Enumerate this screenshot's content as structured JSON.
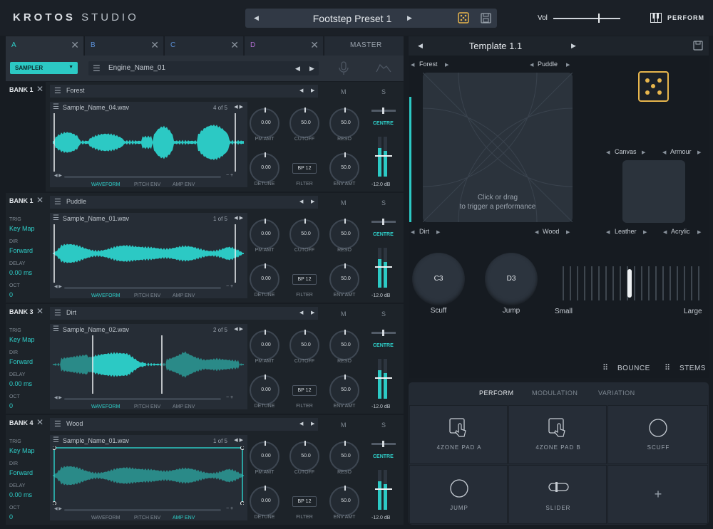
{
  "header": {
    "logo_bold": "KROTOS",
    "logo_light": "STUDIO",
    "preset_name": "Footstep Preset 1",
    "vol_label": "Vol",
    "perform_label": "PERFORM"
  },
  "tabs": [
    {
      "label": "A"
    },
    {
      "label": "B"
    },
    {
      "label": "C"
    },
    {
      "label": "D"
    },
    {
      "label": "MASTER"
    }
  ],
  "engine": {
    "type": "SAMPLER",
    "name": "Engine_Name_01"
  },
  "banks": [
    {
      "bank": "BANK 1",
      "name": "Forest",
      "sample": "Sample_Name_04.wav",
      "page": "4 of 5",
      "options": null,
      "active_tab": "WAVEFORM"
    },
    {
      "bank": "BANK 1",
      "name": "Puddle",
      "sample": "Sample_Name_01.wav",
      "page": "1 of 5",
      "options": {
        "trig_k": "TRIG",
        "trig_v": "Key Map",
        "dir_k": "DIR",
        "dir_v": "Forward",
        "delay_k": "DELAY",
        "delay_v": "0.00 ms",
        "oct_k": "OCT",
        "oct_v": "0"
      },
      "active_tab": "WAVEFORM"
    },
    {
      "bank": "BANK 3",
      "name": "Dirt",
      "sample": "Sample_Name_02.wav",
      "page": "2 of 5",
      "options": {
        "trig_k": "TRIG",
        "trig_v": "Key Map",
        "dir_k": "DIR",
        "dir_v": "Forward",
        "delay_k": "DELAY",
        "delay_v": "0.00 ms",
        "oct_k": "OCT",
        "oct_v": "0"
      },
      "active_tab": "WAVEFORM"
    },
    {
      "bank": "BANK 4",
      "name": "Wood",
      "sample": "Sample_Name_01.wav",
      "page": "1 of 5",
      "options": {
        "trig_k": "TRIG",
        "trig_v": "Key Map",
        "dir_k": "DIR",
        "dir_v": "Forward",
        "delay_k": "DELAY",
        "delay_v": "0.00 ms",
        "oct_k": "OCT",
        "oct_v": "0"
      },
      "active_tab": "AMP ENV"
    }
  ],
  "bank_controls": {
    "pm_amt": "0.00",
    "cutoff": "50.0",
    "reso": "50.0",
    "detune": "0.00",
    "filter": "BP 12",
    "env_amt": "50.0",
    "pm_amt_label": "PM AMT",
    "cutoff_label": "CUTOFF",
    "reso_label": "RESO",
    "detune_label": "DETUNE",
    "filter_label": "FILTER",
    "env_amt_label": "ENV AMT",
    "m": "M",
    "s": "S",
    "centre": "CENTRE",
    "db": "-12.0 dB",
    "tab_waveform": "WAVEFORM",
    "tab_pitch": "PITCH ENV",
    "tab_amp": "AMP ENV"
  },
  "right": {
    "template": "Template 1.1",
    "xy_tl": "Forest",
    "xy_tr": "Puddle",
    "xy_bl": "Dirt",
    "xy_br": "Wood",
    "xy_hint1": "Click or drag",
    "xy_hint2": "to trigger a performance",
    "mini_tl": "Canvas",
    "mini_tr": "Armour",
    "mini_bl": "Leather",
    "mini_br": "Acrylic",
    "pad1_note": "C3",
    "pad1_label": "Scuff",
    "pad2_note": "D3",
    "pad2_label": "Jump",
    "slider_small": "Small",
    "slider_large": "Large",
    "bounce": "BOUNCE",
    "stems": "STEMS"
  },
  "bottom": {
    "tabs": [
      "PERFORM",
      "MODULATION",
      "VARIATION"
    ],
    "cells": [
      "4ZONE PAD A",
      "4ZONE PAD B",
      "SCUFF",
      "JUMP",
      "SLIDER",
      "+"
    ]
  },
  "colors": {
    "accent": "#2cc9c4",
    "dice": "#e8b64d"
  }
}
